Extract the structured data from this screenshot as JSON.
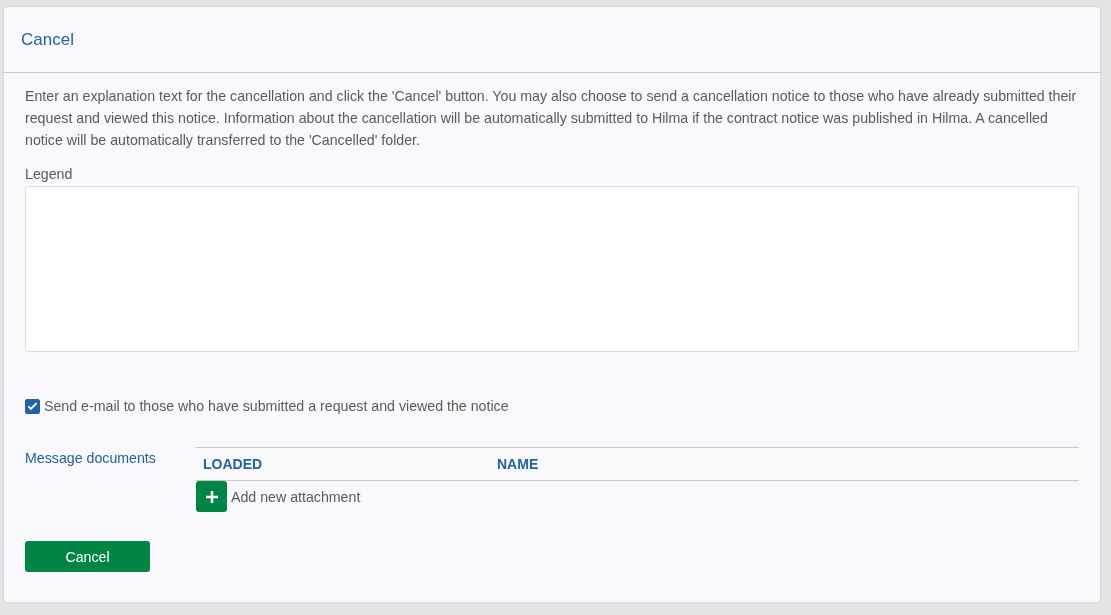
{
  "dialog": {
    "title": "Cancel"
  },
  "instructions": "Enter an explanation text for the cancellation and click the 'Cancel' button. You may also choose to send a cancellation notice to those who have already submitted their request and viewed this notice. Information about the cancellation will be automatically submitted to Hilma if the contract notice was published in Hilma. A cancelled notice will be automatically transferred to the 'Cancelled' folder.",
  "legend": {
    "label": "Legend"
  },
  "send_email": {
    "label": "Send e-mail to those who have submitted a request and viewed the notice",
    "checked": true
  },
  "documents": {
    "label": "Message documents",
    "columns": [
      "LOADED",
      "NAME"
    ],
    "add_label": "Add new attachment"
  },
  "cancel_button": "Cancel"
}
